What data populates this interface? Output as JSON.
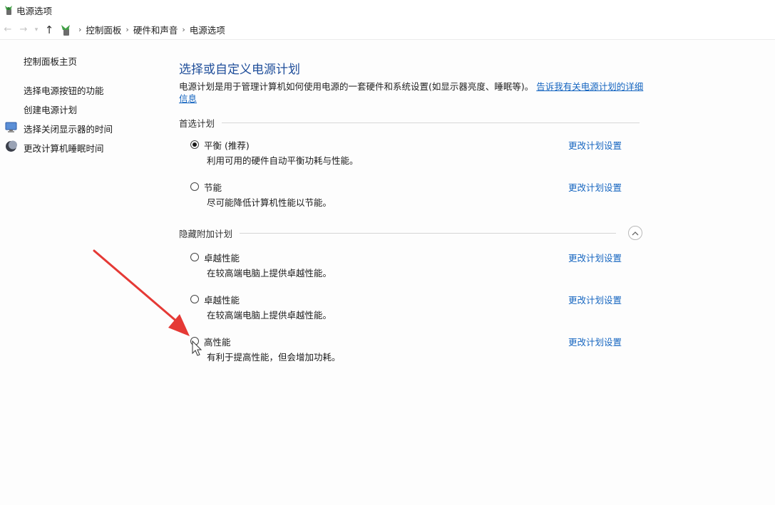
{
  "window": {
    "title": "电源选项"
  },
  "address": {
    "back_icon": "back-arrow-icon",
    "forward_icon": "forward-arrow-icon",
    "crumbs": [
      "控制面板",
      "硬件和声音",
      "电源选项"
    ]
  },
  "sidebar": {
    "home": "控制面板主页",
    "links": [
      {
        "label": "选择电源按钮的功能",
        "icon": null
      },
      {
        "label": "创建电源计划",
        "icon": null
      },
      {
        "label": "选择关闭显示器的时间",
        "icon": "monitor-icon"
      },
      {
        "label": "更改计算机睡眠时间",
        "icon": "moon-sleep-icon"
      }
    ]
  },
  "main": {
    "title": "选择或自定义电源计划",
    "description": "电源计划是用于管理计算机如何使用电源的一套硬件和系统设置(如显示器亮度、睡眠等)。",
    "description_link": "告诉我有关电源计划的详细信息",
    "preferred_section": "首选计划",
    "hidden_section": "隐藏附加计划",
    "change_link": "更改计划设置",
    "preferred_plans": [
      {
        "name": "平衡 (推荐)",
        "desc": "利用可用的硬件自动平衡功耗与性能。",
        "selected": true
      },
      {
        "name": "节能",
        "desc": "尽可能降低计算机性能以节能。",
        "selected": false
      }
    ],
    "hidden_plans": [
      {
        "name": "卓越性能",
        "desc": "在较高端电脑上提供卓越性能。",
        "selected": false
      },
      {
        "name": "卓越性能",
        "desc": "在较高端电脑上提供卓越性能。",
        "selected": false
      },
      {
        "name": "高性能",
        "desc": "有利于提高性能，但会增加功耗。",
        "selected": false
      }
    ]
  },
  "colors": {
    "link": "#1565c0",
    "title": "#1f4e9a",
    "annotation_arrow": "#e53935"
  }
}
